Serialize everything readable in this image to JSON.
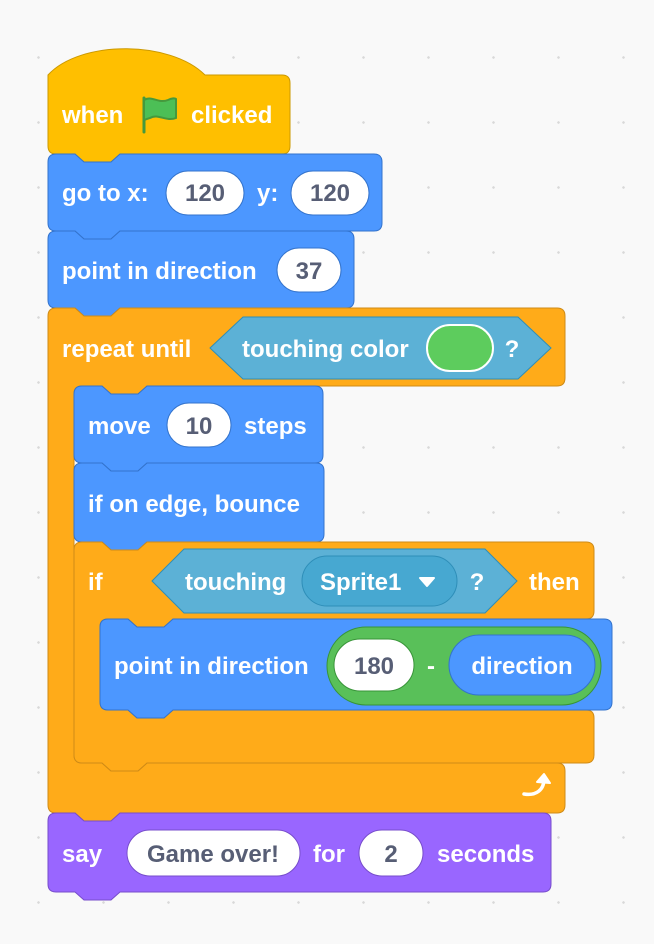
{
  "colors": {
    "events": "#ffbf00",
    "motion": "#4c97ff",
    "control": "#ffab19",
    "sensing": "#5cb1d6",
    "operators": "#59c059",
    "looks": "#9966ff",
    "touch_color_swatch": "#5dcc5d"
  },
  "script": {
    "hat": {
      "when": "when",
      "flag_icon": "green-flag-icon",
      "clicked": "clicked"
    },
    "goto": {
      "label": "go to x:",
      "x": "120",
      "y_label": "y:",
      "y": "120"
    },
    "point1": {
      "label": "point in direction",
      "value": "37"
    },
    "repeat": {
      "label": "repeat until",
      "condition": {
        "label": "touching color",
        "question": "?"
      },
      "loop_icon": "loop-arrow-icon"
    },
    "move": {
      "label": "move",
      "value": "10",
      "suffix": "steps"
    },
    "bounce": {
      "label": "if on edge, bounce"
    },
    "if_block": {
      "label": "if",
      "then": "then",
      "condition": {
        "label": "touching",
        "target": "Sprite1",
        "question": "?"
      }
    },
    "point2": {
      "label": "point in direction",
      "operator": {
        "left": "180",
        "symbol": "-",
        "right": "direction"
      }
    },
    "say": {
      "label": "say",
      "message": "Game over!",
      "for": "for",
      "duration": "2",
      "suffix": "seconds"
    }
  }
}
